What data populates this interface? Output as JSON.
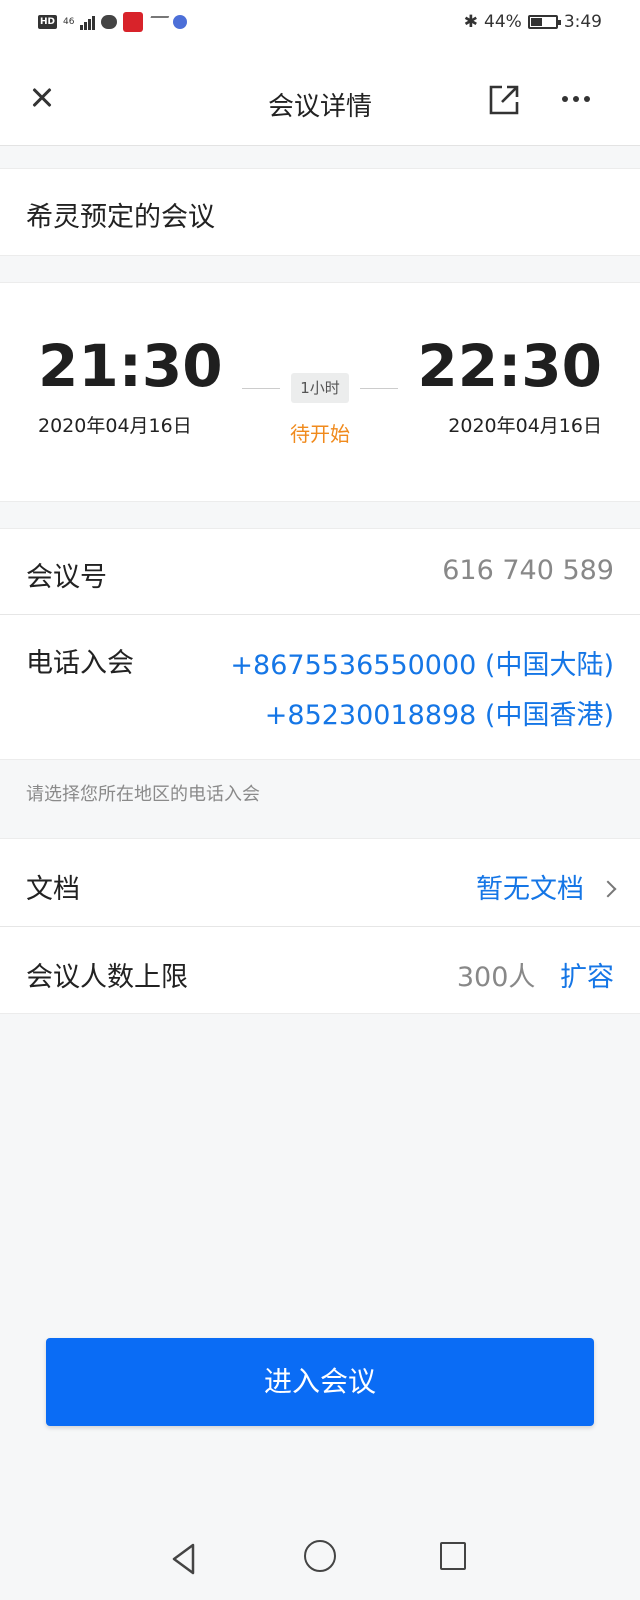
{
  "status_bar": {
    "network": "46",
    "battery_text": "44%",
    "battery_level": 0.44,
    "time": "3:49"
  },
  "nav": {
    "title": "会议详情"
  },
  "meeting": {
    "title": "希灵预定的会议",
    "start_time": "21:30",
    "start_date": "2020年04月16日",
    "end_time": "22:30",
    "end_date": "2020年04月16日",
    "duration": "1小时",
    "status": "待开始",
    "status_color": "#f08a1c"
  },
  "details": {
    "meeting_id_label": "会议号",
    "meeting_id_value": "616 740 589",
    "phone_label": "电话入会",
    "phone_numbers": [
      "+8675536550000 (中国大陆)",
      "+85230018898 (中国香港)"
    ],
    "region_hint": "请选择您所在地区的电话入会",
    "document_label": "文档",
    "document_value": "暂无文档",
    "capacity_label": "会议人数上限",
    "capacity_value": "300人",
    "expand_label": "扩容"
  },
  "actions": {
    "enter_label": "进入会议",
    "primary_color": "#0a6cf5"
  }
}
